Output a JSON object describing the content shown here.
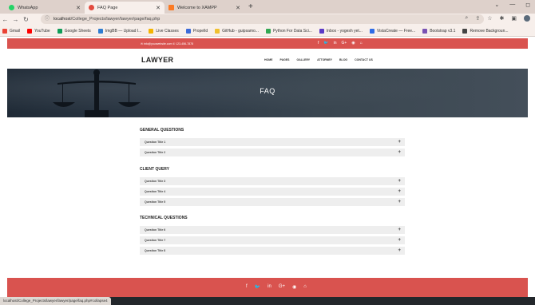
{
  "browser": {
    "tabs": [
      {
        "label": "WhatsApp",
        "color": "#25d366",
        "active": false
      },
      {
        "label": "FAQ Page",
        "color": "#e24b3f",
        "active": true
      },
      {
        "label": "Welcome to XAMPP",
        "color": "#fb7a24",
        "active": false
      }
    ],
    "url_host": "localhost",
    "url_path": "/College_Projects/lawyer/lawyer/page/faq.php",
    "bookmarks": [
      {
        "label": "Gmail",
        "color": "#ea4335"
      },
      {
        "label": "YouTube",
        "color": "#ff0000"
      },
      {
        "label": "Google Sheets",
        "color": "#0f9d58"
      },
      {
        "label": "ImgBB — Upload I...",
        "color": "#2f7dd1"
      },
      {
        "label": "Live Classes",
        "color": "#f4b400"
      },
      {
        "label": "Propelld",
        "color": "#3c6bd8"
      },
      {
        "label": "GitHub - guipsamo...",
        "color": "#f0c030"
      },
      {
        "label": "Python For Data Sci...",
        "color": "#33a853"
      },
      {
        "label": "Inbox - yogesh yet...",
        "color": "#5b3ac7"
      },
      {
        "label": "VistaCreate — Free...",
        "color": "#2e6ce6"
      },
      {
        "label": "Bootstrap v3.1",
        "color": "#7952b3"
      },
      {
        "label": "Remove Backgroun...",
        "color": "#444444"
      }
    ]
  },
  "topbar": {
    "contact": "✉ info@yourwebsite.com   ✆ 123-456-7878",
    "social": [
      "f",
      "🐦",
      "in",
      "G+",
      "◉",
      "⌂"
    ]
  },
  "header": {
    "logo": "LAWYER",
    "menu": [
      "HOME",
      "PAGES",
      "GALLERY",
      "ATTORNEY",
      "BLOG",
      "CONTACT US"
    ]
  },
  "hero": {
    "title": "FAQ"
  },
  "faq": {
    "sections": [
      {
        "title": "GENERAL QUESTIONS",
        "items": [
          "Question Title 1",
          "Question Title 2"
        ]
      },
      {
        "title": "CLIENT QUERY",
        "items": [
          "Question Title 3",
          "Question Title 4",
          "Question Title 5"
        ]
      },
      {
        "title": "TECHNICAL QUESTIONS",
        "items": [
          "Question Title 6",
          "Question Title 7",
          "Question Title 8"
        ]
      }
    ],
    "expand_symbol": "+"
  },
  "footer": {
    "social": [
      "f",
      "🐦",
      "in",
      "G+",
      "◉",
      "⌂"
    ]
  },
  "status": {
    "link": "localhost/College_Projects/lawyer/lawyer/page/faq.php#collapse4"
  }
}
